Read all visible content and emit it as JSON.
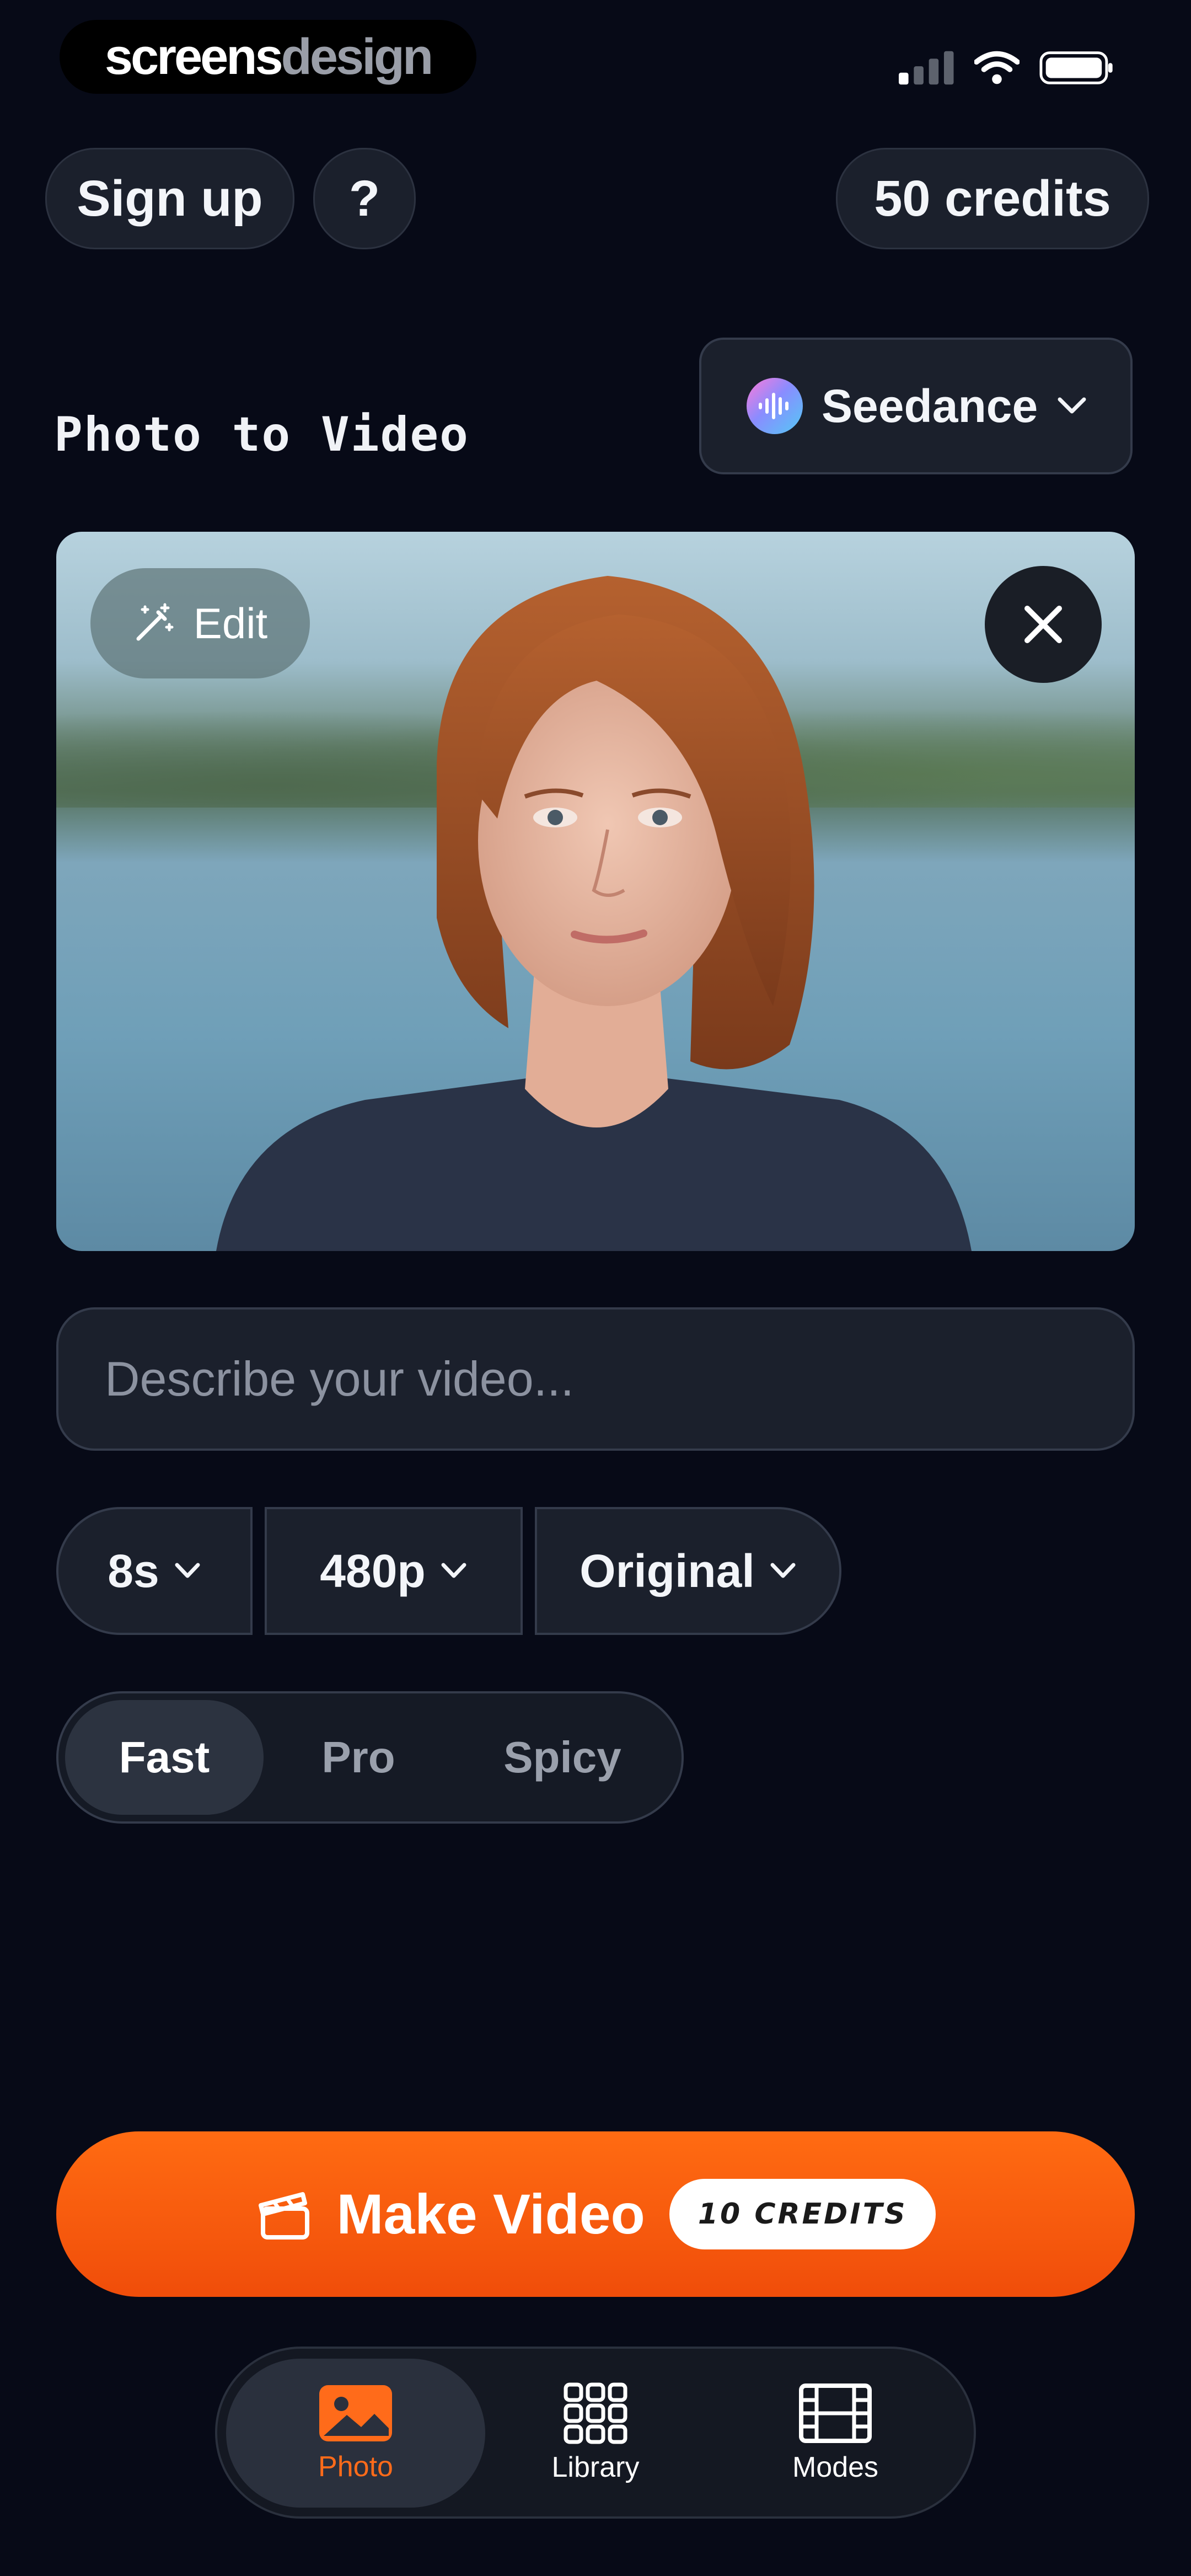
{
  "status_bar": {
    "brand_part1": "screens",
    "brand_part2": "design",
    "icons": [
      "signal-icon",
      "wifi-icon",
      "battery-icon"
    ]
  },
  "top": {
    "signup_label": "Sign up",
    "help_label": "?",
    "credits_label": "50 credits"
  },
  "header": {
    "title": "Photo to Video",
    "model_name": "Seedance"
  },
  "photo": {
    "edit_label": "Edit",
    "icons": [
      "magic-wand-icon",
      "close-icon"
    ]
  },
  "prompt": {
    "placeholder": "Describe your video..."
  },
  "options": {
    "duration": "8s",
    "resolution": "480p",
    "aspect": "Original"
  },
  "modes": {
    "items": [
      "Fast",
      "Pro",
      "Spicy"
    ],
    "selected": "Fast"
  },
  "cta": {
    "label": "Make Video",
    "badge": "10 CREDITS"
  },
  "tabbar": {
    "items": [
      {
        "label": "Photo",
        "icon": "image-icon",
        "active": true
      },
      {
        "label": "Library",
        "icon": "grid-icon",
        "active": false
      },
      {
        "label": "Modes",
        "icon": "film-icon",
        "active": false
      }
    ]
  },
  "colors": {
    "background": "#070a17",
    "accent": "#ff6b12",
    "surface": "#1b202c"
  }
}
